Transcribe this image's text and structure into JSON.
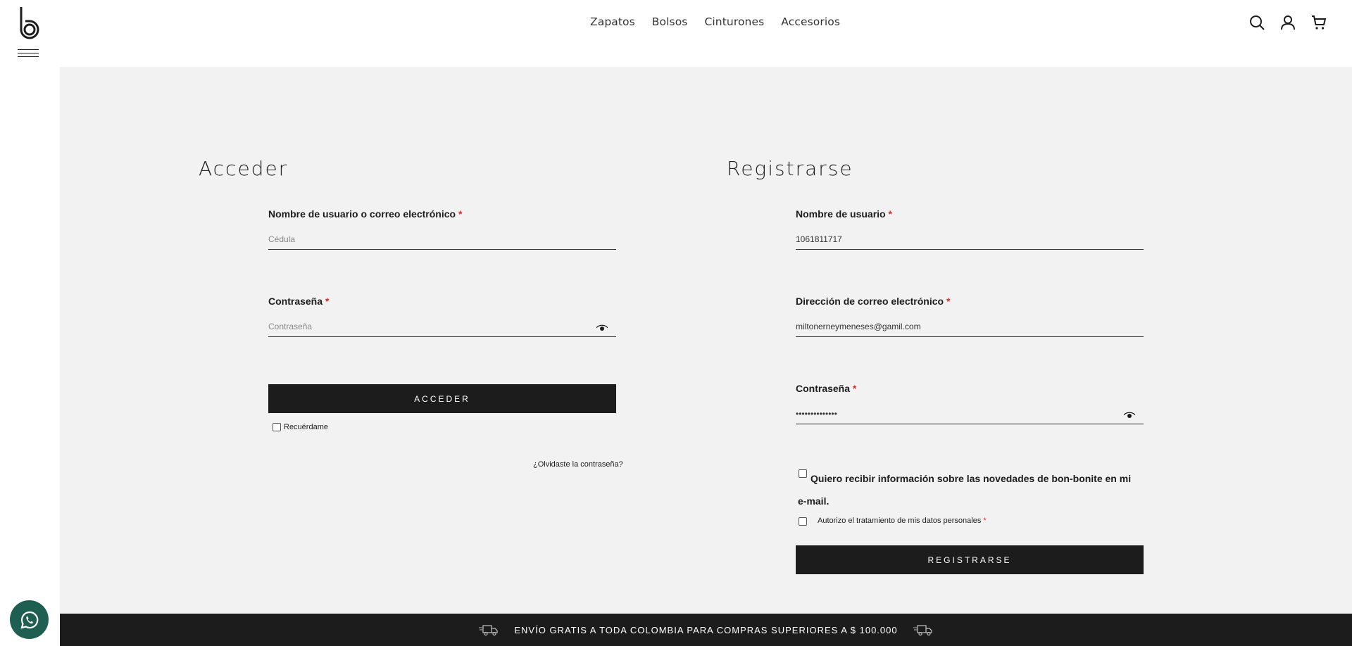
{
  "nav": {
    "items": [
      "Zapatos",
      "Bolsos",
      "Cinturones",
      "Accesorios"
    ]
  },
  "header_icons": [
    "search-icon",
    "user-icon",
    "cart-icon"
  ],
  "login": {
    "title": "Acceder",
    "username_label": "Nombre de usuario o correo electrónico",
    "username_placeholder": "Cédula",
    "username_value": "",
    "password_label": "Contraseña",
    "password_placeholder": "Contraseña",
    "submit_label": "ACCEDER",
    "remember_label": "Recuérdame",
    "forgot_label": "¿Olvidaste la contraseña?"
  },
  "register": {
    "title": "Registrarse",
    "username_label": "Nombre de usuario",
    "username_value": "1061811717",
    "email_label": "Dirección de correo electrónico",
    "email_value": "miltonerneymeneses@gamil.com",
    "password_label": "Contraseña",
    "password_value": "••••••••••••••",
    "newsletter_label": "Quiero recibir información sobre las novedades de bon-bonite en mi e-mail.",
    "privacy_label": "Autorizo el tratamiento de mis datos personales",
    "submit_label": "REGISTRARSE"
  },
  "required_mark": "*",
  "footer": {
    "text": "ENVÍO GRATIS A TODA COLOMBIA PARA COMPRAS SUPERIORES A $ 100.000"
  },
  "colors": {
    "panel_bg": "#f2f2f2",
    "button_bg": "#1c1c1c",
    "required": "#e02b2b",
    "whatsapp": "#1e5f52"
  }
}
